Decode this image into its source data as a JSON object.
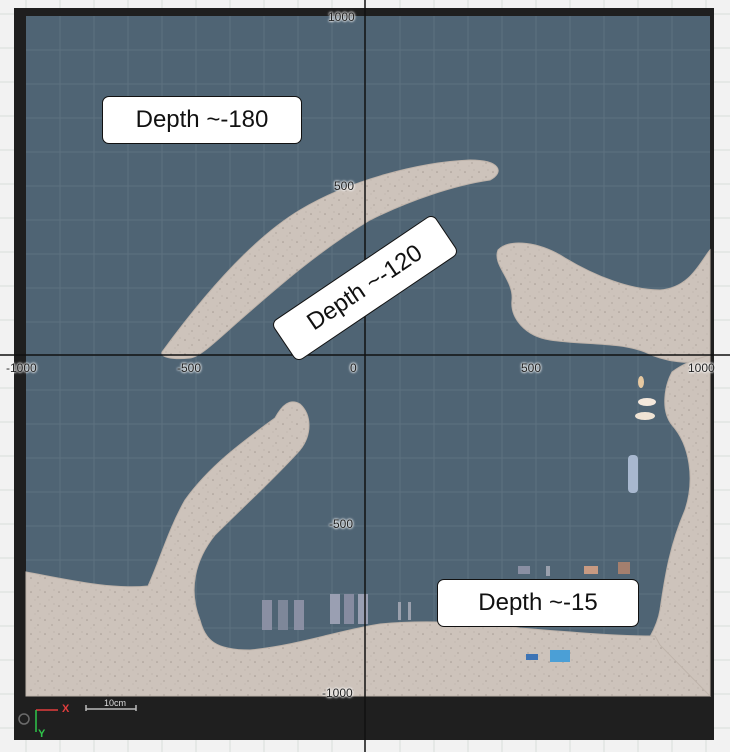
{
  "map": {
    "colors": {
      "water": "#4f6474",
      "land": "#cdc3bb",
      "frame": "#1f1f1f",
      "outer_grid": "#d8dedb",
      "inner_grid": "#5e7280",
      "axis": "#111111"
    },
    "axis_ticks": {
      "x": [
        "-1000",
        "-500",
        "0",
        "500",
        "1000"
      ],
      "y": [
        "1000",
        "500",
        "-500",
        "-1000"
      ]
    },
    "callouts": [
      {
        "id": "deep",
        "text": "Depth ~-180"
      },
      {
        "id": "mid",
        "text": "Depth ~-120"
      },
      {
        "id": "shallow",
        "text": "Depth ~-15"
      }
    ],
    "scale_bar": {
      "label": "10cm"
    },
    "gizmo": {
      "x_label": "X",
      "y_label": "Y"
    }
  }
}
